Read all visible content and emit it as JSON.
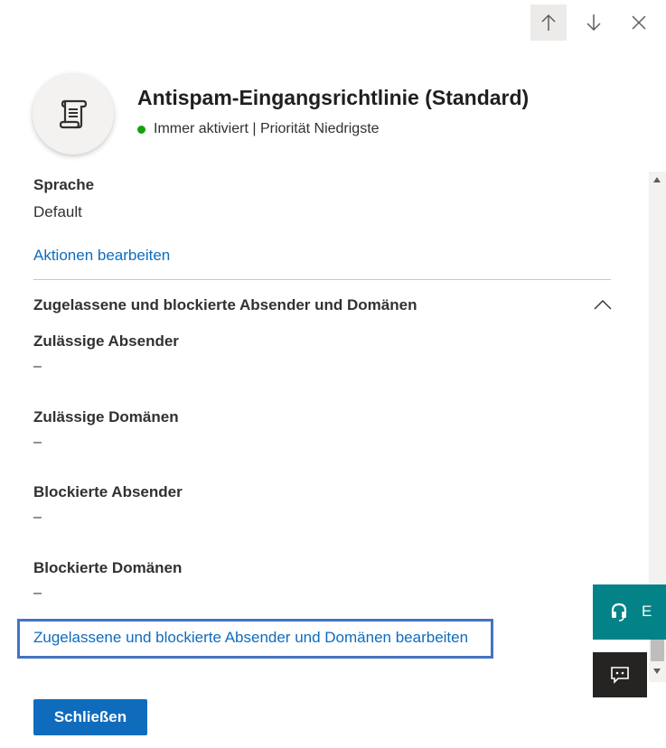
{
  "nav": {
    "up_label": "Nach oben",
    "down_label": "Nach unten",
    "close_label": "Schließen"
  },
  "header": {
    "title": "Antispam-Eingangsrichtlinie (Standard)",
    "status": "Immer aktiviert | Priorität Niedrigste",
    "status_color": "#13a10e",
    "icon": "scroll-icon"
  },
  "language": {
    "label": "Sprache",
    "value": "Default"
  },
  "edit_actions_link": "Aktionen bearbeiten",
  "section": {
    "title": "Zugelassene und blockierte Absender und Domänen",
    "expanded": true,
    "fields": [
      {
        "label": "Zulässige Absender",
        "value": "–"
      },
      {
        "label": "Zulässige Domänen",
        "value": "–"
      },
      {
        "label": "Blockierte Absender",
        "value": "–"
      },
      {
        "label": "Blockierte Domänen",
        "value": "–"
      }
    ],
    "edit_link": "Zugelassene und blockierte Absender und Domänen bearbeiten"
  },
  "footer": {
    "close_button": "Schließen",
    "accent_color": "#0f6cbd"
  },
  "help_widget": {
    "label": "E",
    "color": "#038387"
  },
  "feedback_widget": {
    "icon": "chat-icon"
  }
}
